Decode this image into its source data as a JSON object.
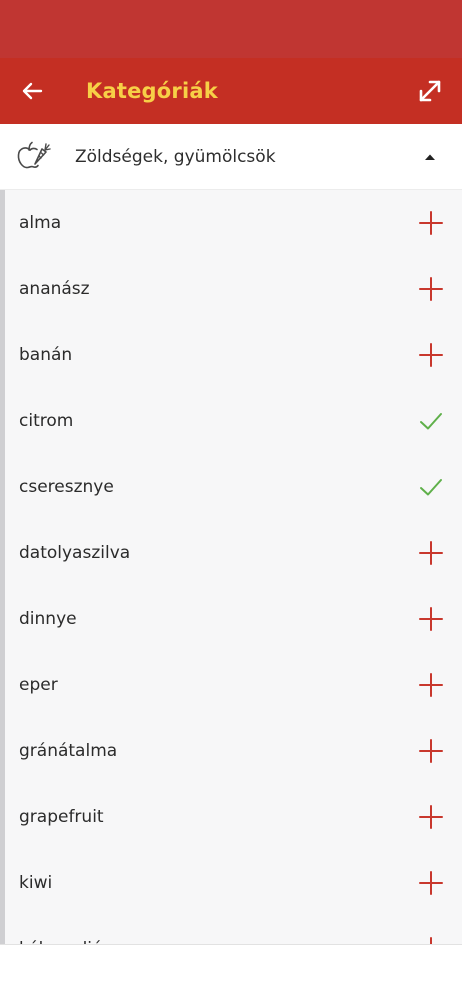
{
  "colors": {
    "status_bar": "#c03632",
    "app_bar": "#c42f23",
    "title": "#f7d047",
    "add_icon": "#c8372d",
    "added_icon": "#5fb04a",
    "list_background": "#f7f7f8"
  },
  "header": {
    "title": "Kategóriák",
    "back_icon": "arrow-left-icon",
    "expand_icon": "expand-diagonal-icon"
  },
  "category": {
    "label": "Zöldségek, gyümölcsök",
    "icon": "fruit-vegetable-icon",
    "expanded": true
  },
  "items": [
    {
      "label": "alma",
      "state": "add"
    },
    {
      "label": "ananász",
      "state": "add"
    },
    {
      "label": "banán",
      "state": "add"
    },
    {
      "label": "citrom",
      "state": "added"
    },
    {
      "label": "cseresznye",
      "state": "added"
    },
    {
      "label": "datolyaszilva",
      "state": "add"
    },
    {
      "label": "dinnye",
      "state": "add"
    },
    {
      "label": "eper",
      "state": "add"
    },
    {
      "label": "gránátalma",
      "state": "add"
    },
    {
      "label": "grapefruit",
      "state": "add"
    },
    {
      "label": "kiwi",
      "state": "add"
    },
    {
      "label": "kókuszdió",
      "state": "add"
    }
  ]
}
